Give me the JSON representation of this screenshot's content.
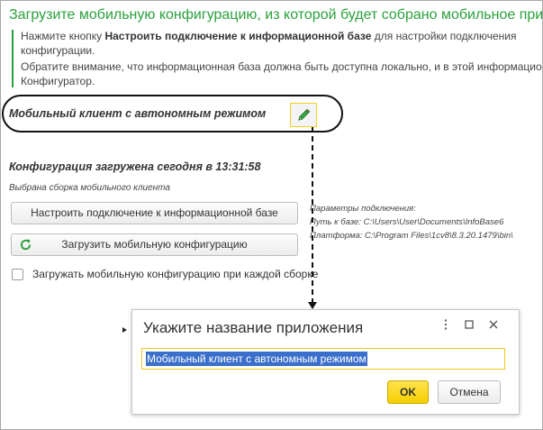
{
  "page": {
    "title": "Загрузите мобильную конфигурацию, из которой будет собрано мобильное приложение"
  },
  "hint": {
    "line1_prefix": "Нажмите кнопку ",
    "line1_bold": "Настроить подключение к информационной базе",
    "line1_suffix": " для настройки подключения",
    "line2": "конфигурации.",
    "line3": "Обратите внимание, что информационная база должна быть доступна локально, и в этой информационной базе",
    "line4": "Конфигуратор."
  },
  "client": {
    "label": "Мобильный клиент с автономным режимом",
    "edit_icon": "pencil-icon"
  },
  "configuration": {
    "loaded_label": "Конфигурация загружена сегодня в 13:31:58",
    "build_label": "Выбрана сборка мобильного клиента",
    "setup_button": "Настроить подключение к информационной базе",
    "load_button": "Загрузить мобильную конфигурацию",
    "load_icon": "refresh-icon",
    "load_each_build_label": "Загружать мобильную конфигурацию при каждой сборке",
    "load_each_build_checked": false
  },
  "connection": {
    "header": "Параметры подключения:",
    "path_line": "Путь к базе: C:\\Users\\User\\Documents\\InfoBase6",
    "platform_line": "Платформа: C:\\Program Files\\1cv8\\8.3.20.1479\\bin\\"
  },
  "dialog": {
    "title": "Укажите название приложения",
    "name_value": "Мобильный клиент с автономным режимом",
    "ok_label": "OK",
    "cancel_label": "Отмена",
    "more_icon": "more-vertical-icon",
    "maximize_icon": "maximize-icon",
    "close_icon": "close-icon"
  },
  "colors": {
    "accent_green": "#2aa13c",
    "focus_yellow": "#f2c81d",
    "ok_yellow": "#f5cf00",
    "selection_blue": "#3a6fcb"
  }
}
